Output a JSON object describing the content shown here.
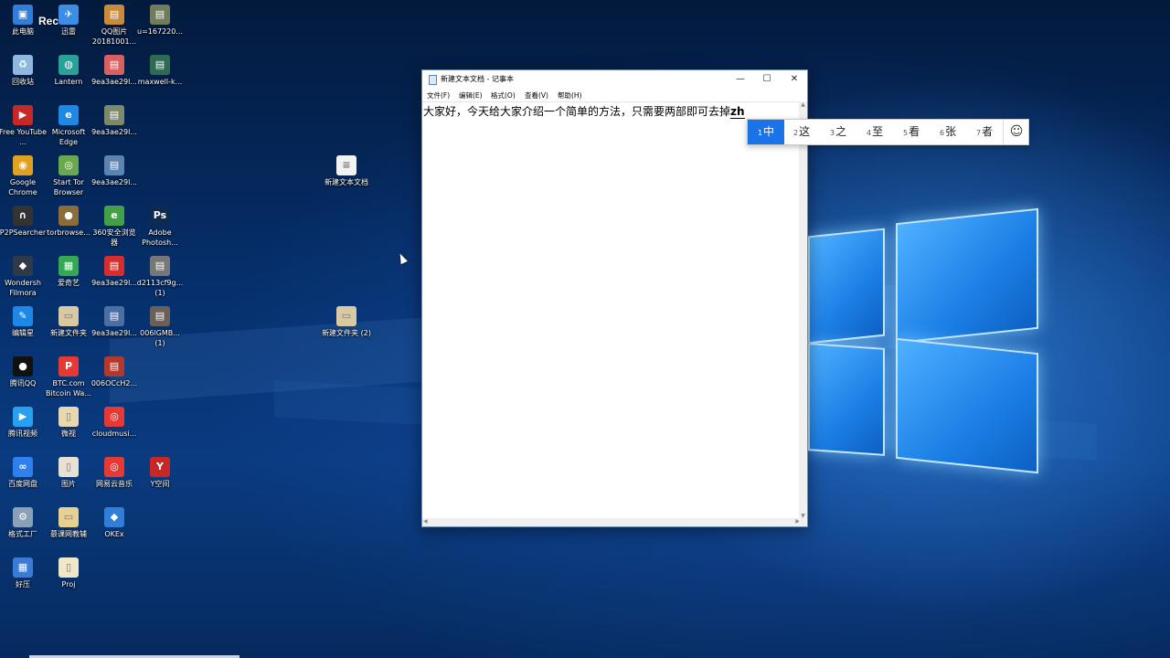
{
  "desktop": {
    "rec_label": "Rec",
    "icons": [
      {
        "label": "此电脑",
        "icon": "computer-icon",
        "color": "#2f7fd9"
      },
      {
        "label": "迅雷",
        "icon": "thunder-icon",
        "color": "#3b8de6"
      },
      {
        "label": "QQ图片20181001...",
        "icon": "image-icon",
        "color": "#c98a3a"
      },
      {
        "label": "u=167220...",
        "icon": "image-icon",
        "color": "#6f7d5a"
      },
      {
        "label": "回收站",
        "icon": "recycle-bin-icon",
        "color": "#8fb8e0"
      },
      {
        "label": "Lantern",
        "icon": "lantern-icon",
        "color": "#2aa198"
      },
      {
        "label": "9ea3ae29l...",
        "icon": "image-icon",
        "color": "#d86060"
      },
      {
        "label": "maxwell-k...",
        "icon": "image-icon",
        "color": "#2e6b55"
      },
      {
        "label": "Free YouTube ...",
        "icon": "youtube-downloader-icon",
        "color": "#c62828"
      },
      {
        "label": "Microsoft Edge",
        "icon": "edge-icon",
        "color": "#1e88e5"
      },
      {
        "label": "9ea3ae29l...",
        "icon": "image-icon",
        "color": "#7a8a6a"
      },
      {
        "label": "Google Chrome",
        "icon": "chrome-icon",
        "color": "#e0a020"
      },
      {
        "label": "Start Tor Browser",
        "icon": "tor-icon",
        "color": "#6aa84f"
      },
      {
        "label": "9ea3ae29l...",
        "icon": "image-icon",
        "color": "#5b84b1"
      },
      {
        "label": "新建文本文档",
        "icon": "text-file-icon",
        "color": "#f2f2f2"
      },
      {
        "label": "P2PSearcher",
        "icon": "headphones-icon",
        "color": "#333333"
      },
      {
        "label": "torbrowse...",
        "icon": "onion-icon",
        "color": "#8a6d3b"
      },
      {
        "label": "360安全浏览器",
        "icon": "browser-360-icon",
        "color": "#43a047"
      },
      {
        "label": "Adobe Photosh...",
        "icon": "photoshop-icon",
        "color": "#0d2b4f"
      },
      {
        "label": "Wondersh Filmora",
        "icon": "filmora-icon",
        "color": "#2e3a48"
      },
      {
        "label": "爱奇艺",
        "icon": "iqiyi-icon",
        "color": "#34a853"
      },
      {
        "label": "9ea3ae29l...",
        "icon": "image-icon",
        "color": "#d32f2f"
      },
      {
        "label": "d2113cf9g... (1)",
        "icon": "image-icon",
        "color": "#777777"
      },
      {
        "label": "编辑星",
        "icon": "editor-icon",
        "color": "#1e88e5"
      },
      {
        "label": "新建文件夹",
        "icon": "folder-icon",
        "color": "#d9c9a3"
      },
      {
        "label": "9ea3ae29l...",
        "icon": "image-icon",
        "color": "#4b6fa5"
      },
      {
        "label": "006lGMB... (1)",
        "icon": "image-icon",
        "color": "#6b5f5a"
      },
      {
        "label": "新建文件夹 (2)",
        "icon": "folder-icon",
        "color": "#d9c9a3"
      },
      {
        "label": "腾讯QQ",
        "icon": "qq-icon",
        "color": "#111111"
      },
      {
        "label": "BTC.com Bitcoin Wa...",
        "icon": "pdf-icon",
        "color": "#e53935"
      },
      {
        "label": "006OCcH2...",
        "icon": "image-icon",
        "color": "#b03a2e"
      },
      {
        "label": "腾讯视频",
        "icon": "tencent-video-icon",
        "color": "#28a0f0"
      },
      {
        "label": "微视",
        "icon": "file-icon",
        "color": "#e8d8b0"
      },
      {
        "label": "cloudmusi...",
        "icon": "netease-music-icon",
        "color": "#e53935"
      },
      {
        "label": "百度网盘",
        "icon": "baidu-netdisk-icon",
        "color": "#2f80ed"
      },
      {
        "label": "图片",
        "icon": "file-icon",
        "color": "#e8e0d0"
      },
      {
        "label": "网易云音乐",
        "icon": "netease-music-icon",
        "color": "#e53935"
      },
      {
        "label": "Y空间",
        "icon": "y-space-icon",
        "color": "#c62828"
      },
      {
        "label": "格式工厂",
        "icon": "format-factory-icon",
        "color": "#8aa0b8"
      },
      {
        "label": "慕课网教辅",
        "icon": "folder-icon",
        "color": "#e8d090"
      },
      {
        "label": "OKEx",
        "icon": "okex-icon",
        "color": "#2f7fd9"
      },
      {
        "label": "好压",
        "icon": "haozip-icon",
        "color": "#3a7bd5"
      },
      {
        "label": "Proj",
        "icon": "file-icon",
        "color": "#f0e6c8"
      }
    ]
  },
  "notepad": {
    "title": "新建文本文档 - 记事本",
    "minimize": "—",
    "maximize": "☐",
    "close": "✕",
    "menu": [
      "文件(F)",
      "编辑(E)",
      "格式(O)",
      "查看(V)",
      "帮助(H)"
    ],
    "content": "大家好，今天给大家介绍一个简单的方法，只需要两部即可去掉",
    "composition": "zh"
  },
  "ime": {
    "candidates": [
      {
        "num": "1",
        "text": "中"
      },
      {
        "num": "2",
        "text": "这"
      },
      {
        "num": "3",
        "text": "之"
      },
      {
        "num": "4",
        "text": "至"
      },
      {
        "num": "5",
        "text": "看"
      },
      {
        "num": "6",
        "text": "张"
      },
      {
        "num": "7",
        "text": "者"
      }
    ],
    "emoji": "☺"
  }
}
